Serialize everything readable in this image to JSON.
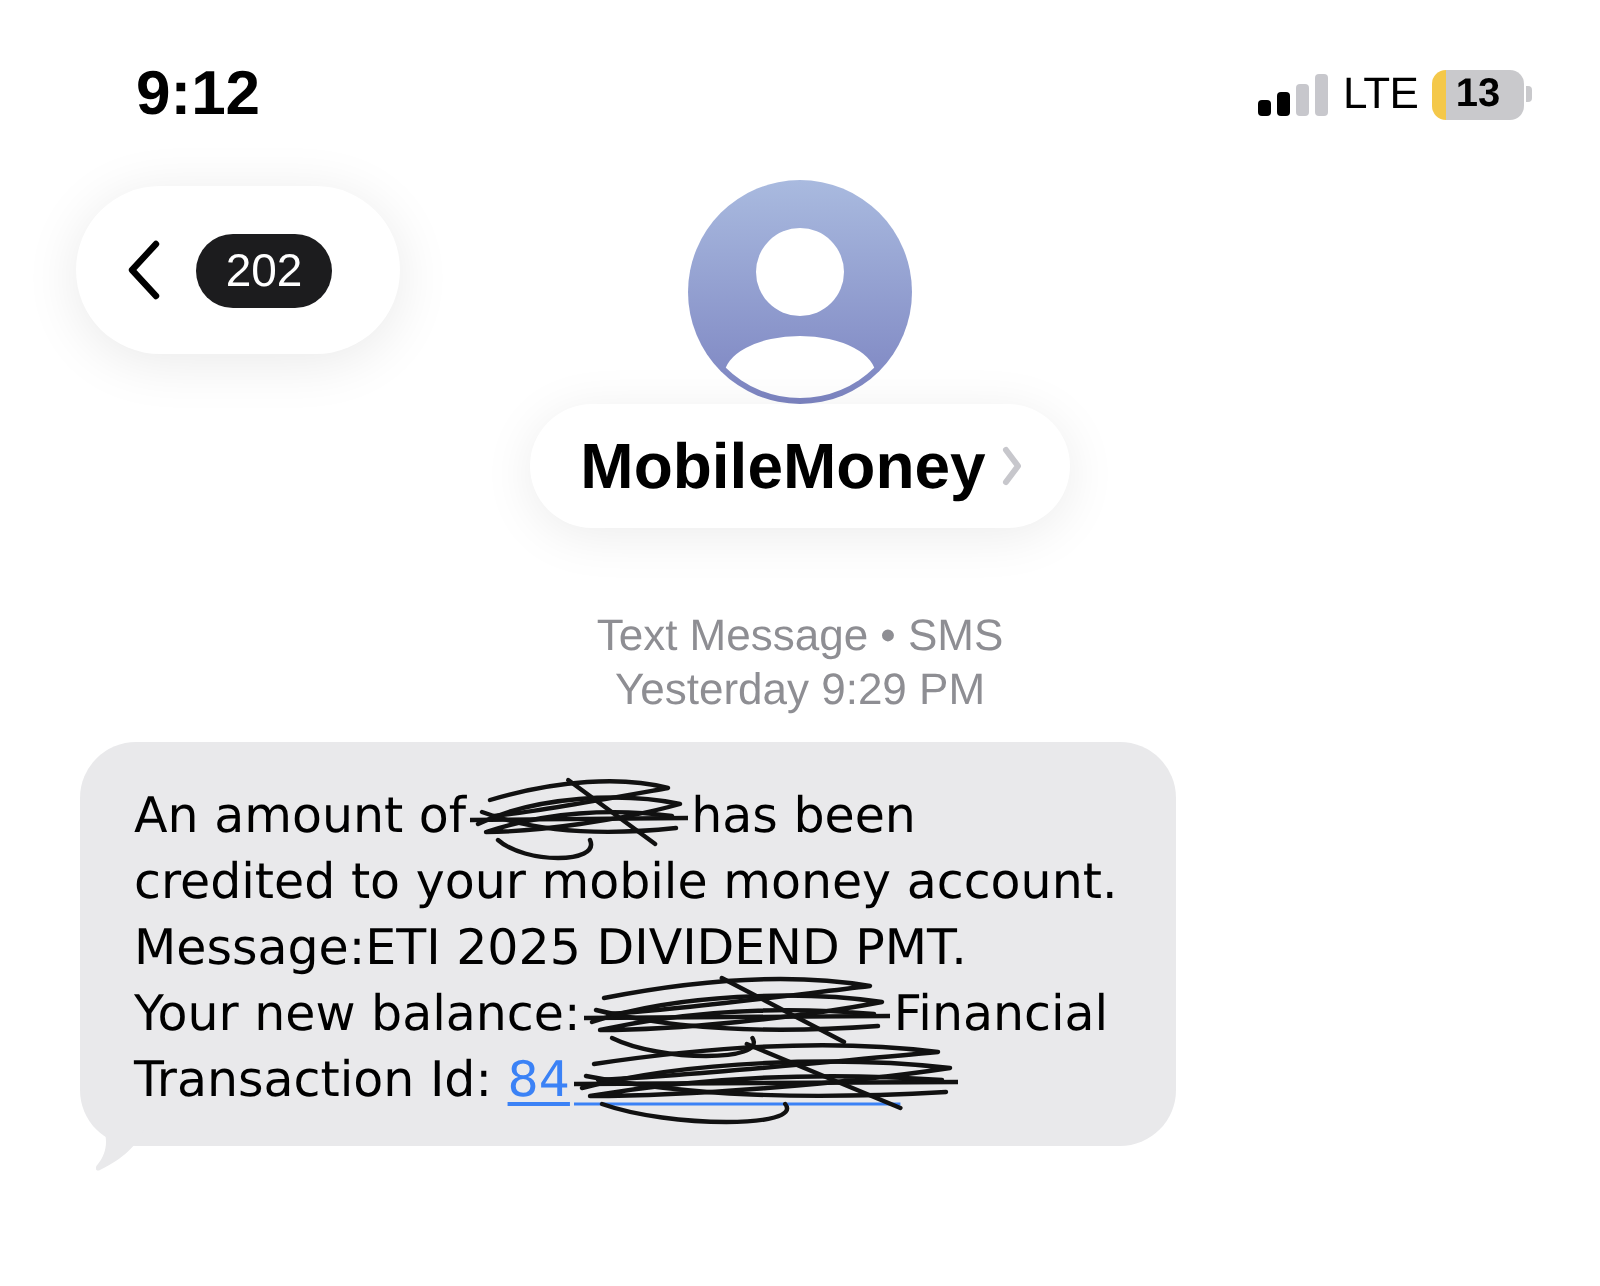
{
  "status_bar": {
    "time": "9:12",
    "network": "LTE",
    "battery": "13"
  },
  "navigation": {
    "back_badge": "202"
  },
  "contact": {
    "name": "MobileMoney"
  },
  "conversation": {
    "service": "Text Message • SMS",
    "timestamp": "Yesterday 9:29 PM"
  },
  "messages": [
    {
      "lines": [
        [
          {
            "kind": "text",
            "text": "An amount of"
          },
          {
            "kind": "redacted"
          },
          {
            "kind": "text",
            "text": "has been"
          }
        ],
        [
          {
            "kind": "text",
            "text": "credited to your mobile money account."
          }
        ],
        [
          {
            "kind": "text",
            "text": "Message:ETI 2025 DIVIDEND PMT."
          }
        ],
        [
          {
            "kind": "text",
            "text": "Your new balance:"
          },
          {
            "kind": "redacted"
          },
          {
            "kind": "text",
            "text": "Financial"
          }
        ],
        [
          {
            "kind": "text",
            "text": "Transaction Id:"
          },
          {
            "kind": "link",
            "text": "84"
          },
          {
            "kind": "redacted"
          }
        ]
      ]
    }
  ]
}
